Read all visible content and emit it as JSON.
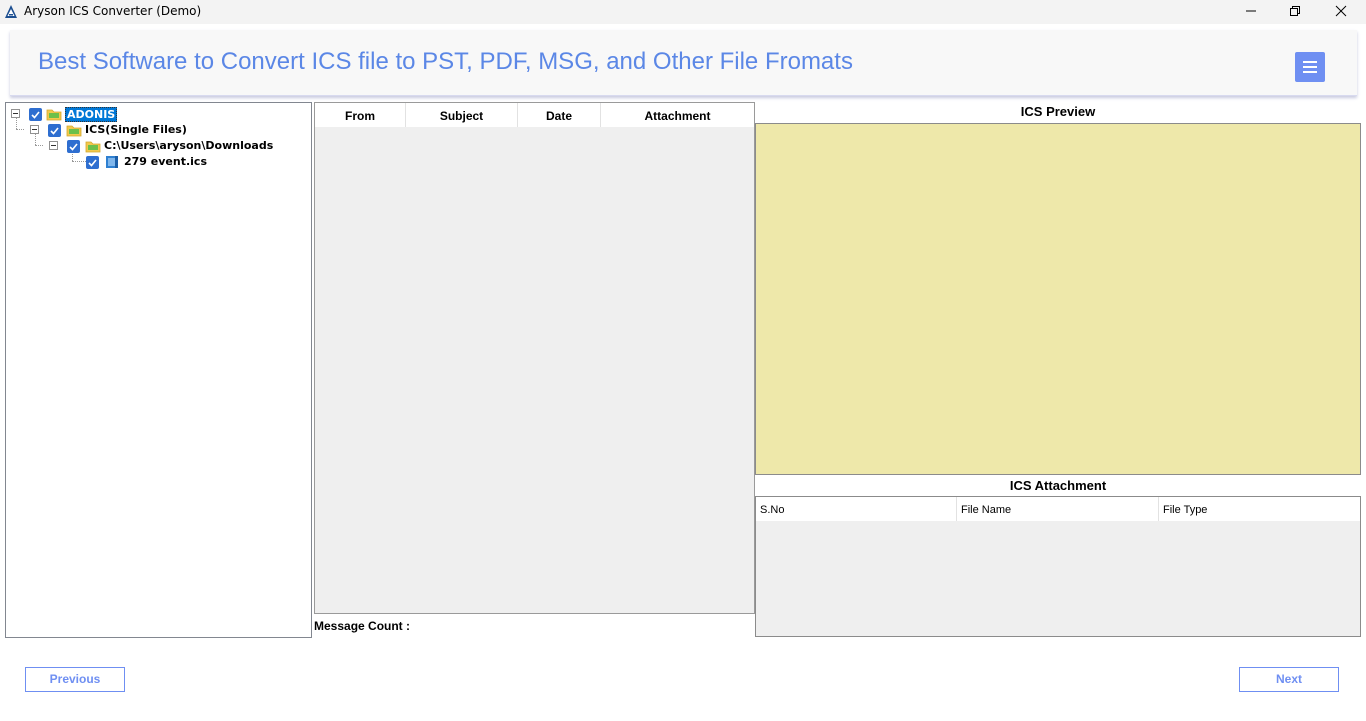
{
  "window": {
    "title": "Aryson ICS Converter (Demo)",
    "controls": [
      "minimize-icon",
      "restore-icon",
      "close-icon"
    ]
  },
  "header": {
    "headline": "Best Software to Convert ICS file to PST, PDF, MSG, and Other File Fromats",
    "menu_icon": "hamburger-icon",
    "accent_color": "#5b87e6",
    "button_color": "#6f8ff2"
  },
  "tree": {
    "nodes": [
      {
        "label": "ADONIS",
        "checked": true,
        "selected": true,
        "icon": "folder-icon"
      },
      {
        "label": "ICS(Single Files)",
        "checked": true,
        "icon": "folder-icon"
      },
      {
        "label": "C:\\Users\\aryson\\Downloads",
        "checked": true,
        "icon": "folder-icon"
      },
      {
        "label": "279 event.ics",
        "checked": true,
        "icon": "calendar-file-icon"
      }
    ]
  },
  "message_grid": {
    "columns": [
      "From",
      "Subject",
      "Date",
      "Attachment"
    ],
    "rows": [],
    "count_label": "Message Count :"
  },
  "preview": {
    "title": "ICS Preview",
    "background": "#eee8aa"
  },
  "attachments": {
    "title": "ICS Attachment",
    "columns": [
      "S.No",
      "File Name",
      "File Type"
    ],
    "rows": []
  },
  "footer": {
    "previous_label": "Previous",
    "next_label": "Next"
  }
}
